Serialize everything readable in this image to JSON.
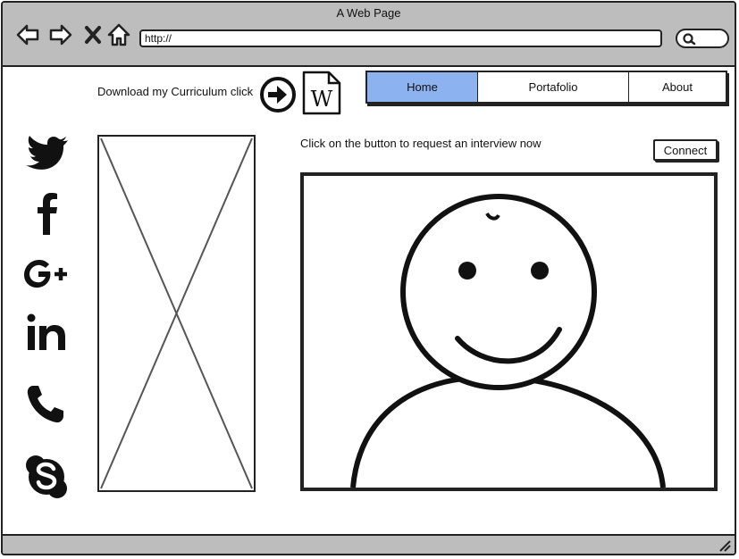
{
  "window": {
    "title": "A Web Page"
  },
  "browser": {
    "url": "http://",
    "nav_icons": [
      "back-arrow-icon",
      "forward-arrow-icon",
      "close-x-icon",
      "home-icon"
    ],
    "search_icon": "magnifier-icon"
  },
  "header": {
    "cv_text": "Download my Curriculum click",
    "arrow_icon": "circle-arrow-right-icon",
    "file_icon": "word-document-icon",
    "file_letter": "W"
  },
  "tabs": [
    {
      "label": "Home",
      "selected": true
    },
    {
      "label": "Portafolio",
      "selected": false
    },
    {
      "label": "About",
      "selected": false
    }
  ],
  "social_icons": [
    "twitter-icon",
    "facebook-icon",
    "google-plus-icon",
    "linkedin-icon",
    "phone-icon",
    "skype-icon"
  ],
  "main": {
    "interview_text": "Click on the button to request an interview now",
    "connect_label": "Connect",
    "image_placeholder_icon": "image-placeholder-x",
    "video_icon": "smiley-person-icon"
  },
  "colors": {
    "chrome": "#bdbdbd",
    "selected_tab": "#8db2f0",
    "stroke": "#222222"
  }
}
